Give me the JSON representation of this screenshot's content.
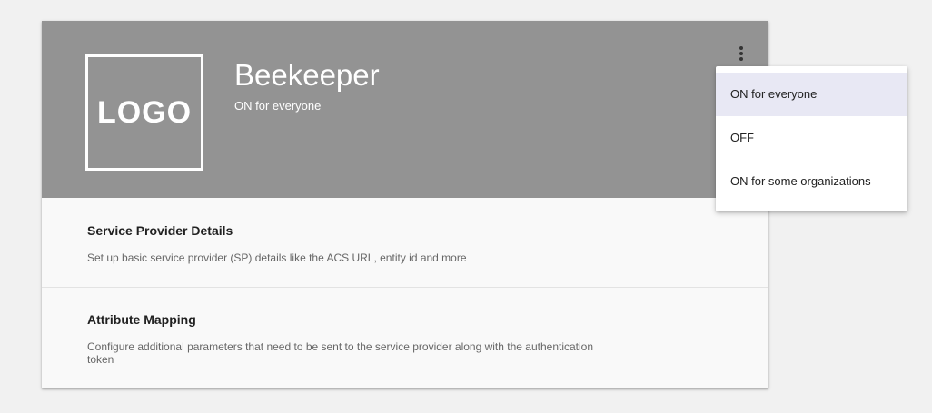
{
  "app": {
    "logo_text": "LOGO",
    "title": "Beekeeper",
    "status": "ON for everyone",
    "more_icon": "more-vert-icon"
  },
  "sections": [
    {
      "title": "Service Provider Details",
      "description": "Set up basic service provider (SP) details like the ACS URL, entity id and more"
    },
    {
      "title": "Attribute Mapping",
      "description": "Configure additional parameters that need to be sent to the service provider along with the authentication token"
    }
  ],
  "status_menu": {
    "selected": "ON for everyone",
    "options": [
      "ON for everyone",
      "OFF",
      "ON for some organizations"
    ]
  },
  "colors": {
    "header_background": "#939393",
    "menu_selected_background": "#e8e8f4"
  }
}
